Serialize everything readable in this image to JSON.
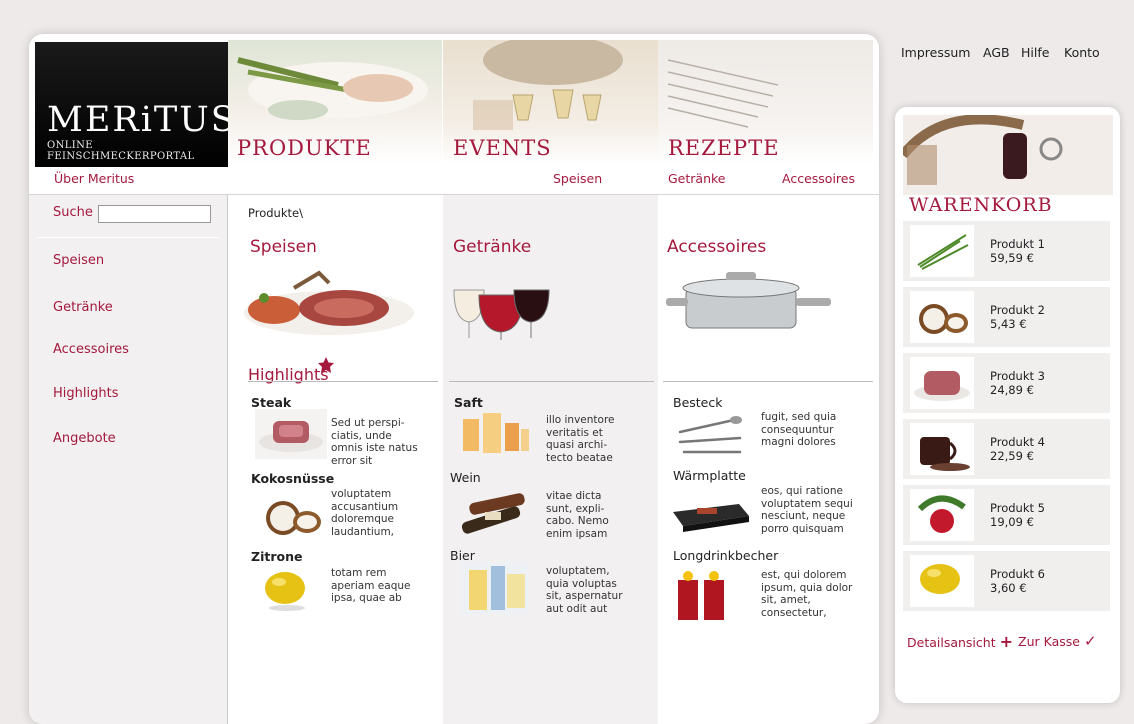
{
  "top_links": [
    "Impressum",
    "AGB",
    "Hilfe",
    "Konto"
  ],
  "logo": {
    "title": "MERiTUS",
    "subtitle": "ONLINE FEINSCHMECKERPORTAL"
  },
  "nav": {
    "produkte": "PRODUKTE",
    "events": "EVENTS",
    "rezepte": "REZEPTE",
    "ueber": "Über Meritus",
    "sub": [
      "Speisen",
      "Getränke",
      "Accessoires"
    ]
  },
  "search": {
    "label": "Suche",
    "placeholder": ""
  },
  "sidebar": [
    "Speisen",
    "Getränke",
    "Accessoires",
    "Highlights",
    "Angebote"
  ],
  "breadcrumb": "Produkte\\",
  "categories": [
    "Speisen",
    "Getränke",
    "Accessoires"
  ],
  "highlights_title": "Highlights",
  "columns": [
    [
      {
        "title": "Steak",
        "text": [
          "Sed ut perspi-",
          "ciatis, unde",
          "omnis iste natus",
          "error sit"
        ],
        "icon": "steak-icon"
      },
      {
        "title": "Kokosnüsse",
        "text": [
          "voluptatem",
          "accusantium",
          "doloremque",
          "laudantium,"
        ],
        "icon": "coconut-icon"
      },
      {
        "title": "Zitrone",
        "text": [
          "totam rem",
          "aperiam eaque",
          "ipsa, quae ab"
        ],
        "icon": "lemon-icon"
      }
    ],
    [
      {
        "title": "Saft",
        "text": [
          "illo inventore",
          "veritatis et",
          "quasi archi-",
          "tecto beatae"
        ],
        "icon": "juice-icon"
      },
      {
        "title": "Wein",
        "text": [
          "vitae dicta",
          "sunt, expli-",
          "cabo. Nemo",
          "enim ipsam"
        ],
        "icon": "wine-icon"
      },
      {
        "title": "Bier",
        "text": [
          "voluptatem,",
          "quia voluptas",
          "sit, aspernatur",
          "aut odit aut"
        ],
        "icon": "beer-icon"
      }
    ],
    [
      {
        "title": "Besteck",
        "text": [
          "fugit, sed quia",
          "consequuntur",
          "magni dolores"
        ],
        "icon": "cutlery-icon"
      },
      {
        "title": "Wärmplatte",
        "text": [
          "eos, qui ratione",
          "voluptatem sequi",
          "nesciunt, neque",
          "porro quisquam"
        ],
        "icon": "warming-plate-icon"
      },
      {
        "title": "Longdrinkbecher",
        "text": [
          "est, qui dolorem",
          "ipsum, quia dolor",
          "sit, amet,",
          "consectetur,"
        ],
        "icon": "glasses-icon"
      }
    ]
  ],
  "cart": {
    "title": "WARENKORB",
    "items": [
      {
        "name": "Produkt 1",
        "price": "59,59 €",
        "icon": "herbs-icon"
      },
      {
        "name": "Produkt 2",
        "price": "5,43 €",
        "icon": "coconut-icon"
      },
      {
        "name": "Produkt 3",
        "price": "24,89 €",
        "icon": "meat-icon"
      },
      {
        "name": "Produkt 4",
        "price": "22,59 €",
        "icon": "coffee-icon"
      },
      {
        "name": "Produkt 5",
        "price": "19,09 €",
        "icon": "radish-icon"
      },
      {
        "name": "Produkt 6",
        "price": "3,60 €",
        "icon": "lemon-icon"
      }
    ],
    "detail_link": "Detailsansicht",
    "checkout_link": "Zur Kasse"
  },
  "colors": {
    "accent": "#a4193d",
    "background": "#eeeaea",
    "panel": "#f1eeee"
  }
}
